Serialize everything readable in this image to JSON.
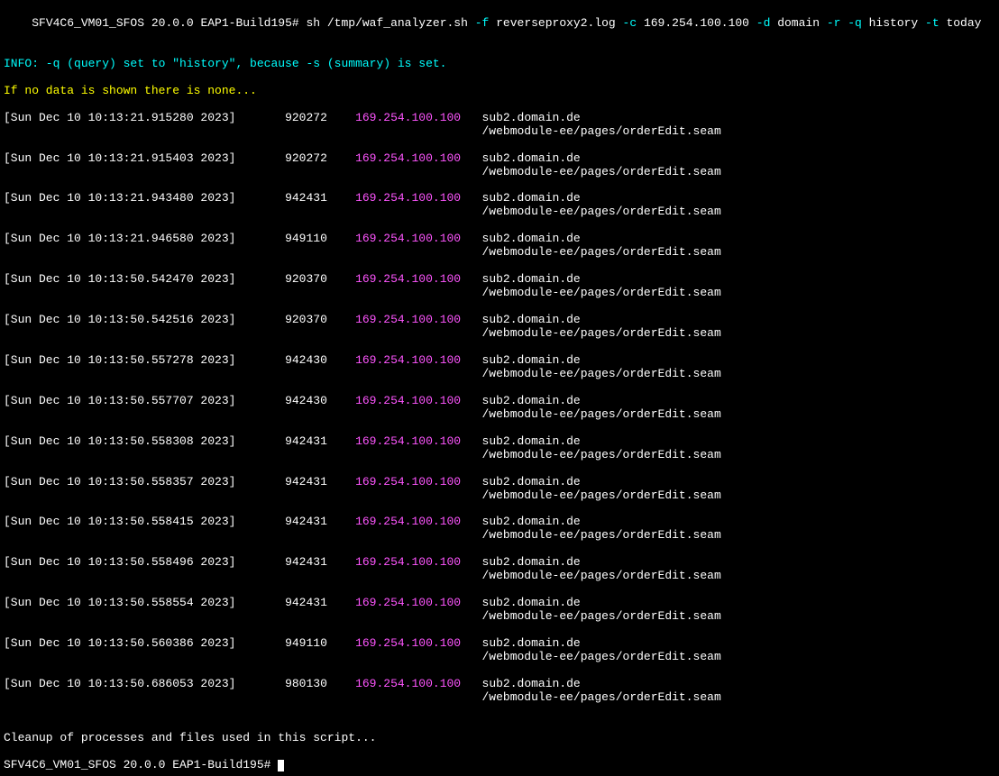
{
  "prompt": "SFV4C6_VM01_SFOS 20.0.0 EAP1-Build195# ",
  "command": {
    "exec": "sh /tmp/waf_analyzer.sh ",
    "flag_f": "-f",
    "arg_f": " reverseproxy2.log ",
    "flag_c": "-c",
    "arg_c": " 169.254.100.100 ",
    "flag_d": "-d",
    "arg_d": " domain ",
    "flag_r": "-r ",
    "flag_q": "-q",
    "arg_q": " history ",
    "flag_t": "-t",
    "arg_t": " today"
  },
  "info_line": "INFO: -q (query) set to \"history\", because -s (summary) is set.",
  "notice_line": "If no data is shown there is none...",
  "log_entries": [
    {
      "ts": "[Sun Dec 10 10:13:21.915280 2023]",
      "id": "920272",
      "ip": "169.254.100.100",
      "dom": "sub2.domain.de",
      "path": "/webmodule-ee/pages/orderEdit.seam"
    },
    {
      "ts": "[Sun Dec 10 10:13:21.915403 2023]",
      "id": "920272",
      "ip": "169.254.100.100",
      "dom": "sub2.domain.de",
      "path": "/webmodule-ee/pages/orderEdit.seam"
    },
    {
      "ts": "[Sun Dec 10 10:13:21.943480 2023]",
      "id": "942431",
      "ip": "169.254.100.100",
      "dom": "sub2.domain.de",
      "path": "/webmodule-ee/pages/orderEdit.seam"
    },
    {
      "ts": "[Sun Dec 10 10:13:21.946580 2023]",
      "id": "949110",
      "ip": "169.254.100.100",
      "dom": "sub2.domain.de",
      "path": "/webmodule-ee/pages/orderEdit.seam"
    },
    {
      "ts": "[Sun Dec 10 10:13:50.542470 2023]",
      "id": "920370",
      "ip": "169.254.100.100",
      "dom": "sub2.domain.de",
      "path": "/webmodule-ee/pages/orderEdit.seam"
    },
    {
      "ts": "[Sun Dec 10 10:13:50.542516 2023]",
      "id": "920370",
      "ip": "169.254.100.100",
      "dom": "sub2.domain.de",
      "path": "/webmodule-ee/pages/orderEdit.seam"
    },
    {
      "ts": "[Sun Dec 10 10:13:50.557278 2023]",
      "id": "942430",
      "ip": "169.254.100.100",
      "dom": "sub2.domain.de",
      "path": "/webmodule-ee/pages/orderEdit.seam"
    },
    {
      "ts": "[Sun Dec 10 10:13:50.557707 2023]",
      "id": "942430",
      "ip": "169.254.100.100",
      "dom": "sub2.domain.de",
      "path": "/webmodule-ee/pages/orderEdit.seam"
    },
    {
      "ts": "[Sun Dec 10 10:13:50.558308 2023]",
      "id": "942431",
      "ip": "169.254.100.100",
      "dom": "sub2.domain.de",
      "path": "/webmodule-ee/pages/orderEdit.seam"
    },
    {
      "ts": "[Sun Dec 10 10:13:50.558357 2023]",
      "id": "942431",
      "ip": "169.254.100.100",
      "dom": "sub2.domain.de",
      "path": "/webmodule-ee/pages/orderEdit.seam"
    },
    {
      "ts": "[Sun Dec 10 10:13:50.558415 2023]",
      "id": "942431",
      "ip": "169.254.100.100",
      "dom": "sub2.domain.de",
      "path": "/webmodule-ee/pages/orderEdit.seam"
    },
    {
      "ts": "[Sun Dec 10 10:13:50.558496 2023]",
      "id": "942431",
      "ip": "169.254.100.100",
      "dom": "sub2.domain.de",
      "path": "/webmodule-ee/pages/orderEdit.seam"
    },
    {
      "ts": "[Sun Dec 10 10:13:50.558554 2023]",
      "id": "942431",
      "ip": "169.254.100.100",
      "dom": "sub2.domain.de",
      "path": "/webmodule-ee/pages/orderEdit.seam"
    },
    {
      "ts": "[Sun Dec 10 10:13:50.560386 2023]",
      "id": "949110",
      "ip": "169.254.100.100",
      "dom": "sub2.domain.de",
      "path": "/webmodule-ee/pages/orderEdit.seam"
    },
    {
      "ts": "[Sun Dec 10 10:13:50.686053 2023]",
      "id": "980130",
      "ip": "169.254.100.100",
      "dom": "sub2.domain.de",
      "path": "/webmodule-ee/pages/orderEdit.seam"
    }
  ],
  "cleanup_line": "Cleanup of processes and files used in this script...",
  "prompt2": "SFV4C6_VM01_SFOS 20.0.0 EAP1-Build195# "
}
